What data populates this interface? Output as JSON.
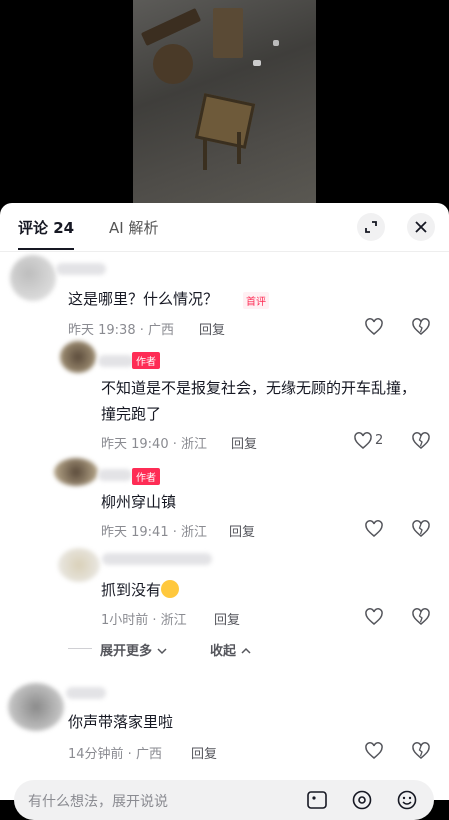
{
  "sheet": {
    "tabs": {
      "comments": "评论 24",
      "ai": "AI 解析"
    }
  },
  "comments": [
    {
      "text": "这是哪里？什么情况？",
      "badge": "首评",
      "time": "昨天 19:38 · 广西",
      "reply": "回复"
    },
    {
      "text": "不知道是不是报复社会，无缘无顾的开车乱撞，撞完跑了",
      "badge": "作者",
      "time": "昨天 19:40 · 浙江",
      "reply": "回复",
      "likes": "2"
    },
    {
      "text": "柳州穿山镇",
      "badge": "作者",
      "time": "昨天 19:41 · 浙江",
      "reply": "回复"
    },
    {
      "text": "抓到没有",
      "time": "1小时前 · 浙江",
      "reply": "回复"
    },
    {
      "text": "你声带落家里啦",
      "time": "14分钟前 · 广西",
      "reply": "回复"
    }
  ],
  "thread": {
    "expand_more": "展开更多",
    "collapse": "收起"
  },
  "input": {
    "placeholder": "有什么想法，展开说说"
  },
  "colors": {
    "accent": "#fe2c55",
    "text": "#161823",
    "meta": "#8a8b91"
  },
  "icons": [
    "expand-icon",
    "close-icon",
    "heart-icon",
    "dislike-icon",
    "image-icon",
    "at-icon",
    "emoji-icon",
    "chevron-down-icon",
    "chevron-up-icon"
  ]
}
